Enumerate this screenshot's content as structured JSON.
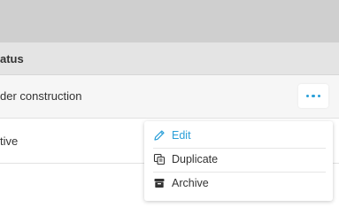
{
  "table": {
    "header": {
      "status_label": "atus"
    },
    "rows": [
      {
        "status": "der construction"
      },
      {
        "status": "tive"
      }
    ]
  },
  "row_actions": {
    "more_icon": "more-horizontal-icon"
  },
  "menu": {
    "items": [
      {
        "label": "Edit",
        "icon": "pencil-icon"
      },
      {
        "label": "Duplicate",
        "icon": "copy-icon"
      },
      {
        "label": "Archive",
        "icon": "archive-box-icon"
      }
    ]
  },
  "colors": {
    "accent": "#2a9fd8",
    "top_band": "#cfcfcf",
    "header_bg": "#e4e4e4",
    "row_hover": "#f6f6f6",
    "text": "#333333"
  }
}
